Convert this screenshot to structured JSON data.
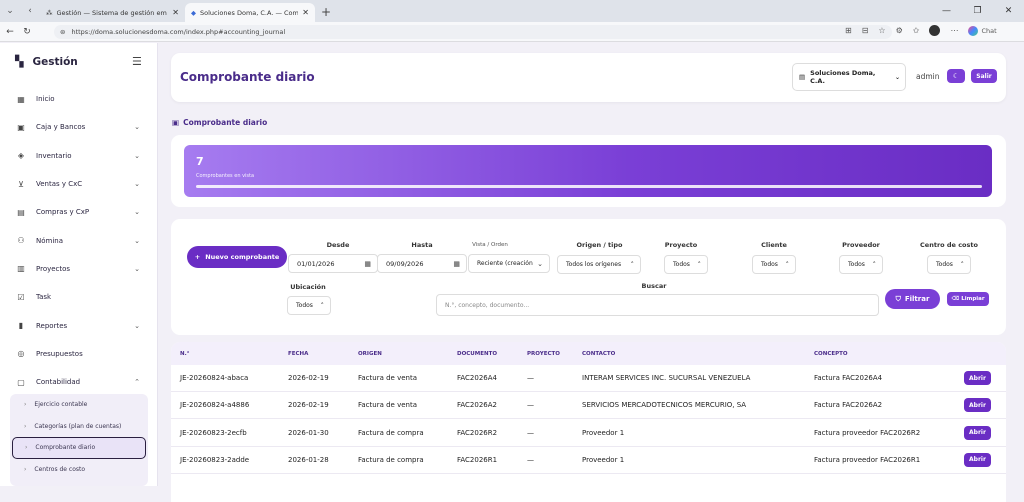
{
  "browser": {
    "tabs": [
      {
        "title": "Gestión — Sistema de gestión em",
        "active": false
      },
      {
        "title": "Soluciones Doma, C.A. — Compr",
        "active": true
      }
    ],
    "url": "https://doma.solucionesdoma.com/index.php#accounting_journal",
    "chat_label": "Chat"
  },
  "sidebar": {
    "brand": "Gestión",
    "items": [
      {
        "label": "Inicio",
        "icon": "dashboard-icon",
        "glyph": "▦",
        "chevron": ""
      },
      {
        "label": "Caja y Bancos",
        "icon": "bank-icon",
        "glyph": "▣",
        "chevron": "⌄"
      },
      {
        "label": "Inventario",
        "icon": "box-icon",
        "glyph": "◈",
        "chevron": "⌄"
      },
      {
        "label": "Ventas y CxC",
        "icon": "cart-icon",
        "glyph": "⊻",
        "chevron": "⌄"
      },
      {
        "label": "Compras y CxP",
        "icon": "truck-icon",
        "glyph": "▤",
        "chevron": "⌄"
      },
      {
        "label": "Nómina",
        "icon": "users-icon",
        "glyph": "⚇",
        "chevron": "⌄"
      },
      {
        "label": "Proyectos",
        "icon": "briefcase-icon",
        "glyph": "▥",
        "chevron": "⌄"
      },
      {
        "label": "Task",
        "icon": "checkbox-icon",
        "glyph": "☑",
        "chevron": ""
      },
      {
        "label": "Reportes",
        "icon": "bar-chart-icon",
        "glyph": "▮",
        "chevron": "⌄"
      },
      {
        "label": "Presupuestos",
        "icon": "target-icon",
        "glyph": "◎",
        "chevron": ""
      },
      {
        "label": "Contabilidad",
        "icon": "ledger-icon",
        "glyph": "▢",
        "chevron": "⌃"
      }
    ],
    "submenu": [
      {
        "label": "Ejercicio contable"
      },
      {
        "label": "Categorías (plan de cuentas)"
      },
      {
        "label": "Comprobante diario"
      },
      {
        "label": "Centros de costo"
      }
    ]
  },
  "header": {
    "title": "Comprobante diario",
    "company": "Soluciones Doma, C.A.",
    "user": "admin",
    "logout": "Salir"
  },
  "section_title": "Comprobante diario",
  "stats": {
    "count": "7",
    "label": "Comprobantes en vista"
  },
  "filters": {
    "new_button": "Nuevo comprobante",
    "desde_label": "Desde",
    "desde_value": "01/01/2026",
    "hasta_label": "Hasta",
    "hasta_value": "09/09/2026",
    "vista_label": "Vista / Orden",
    "vista_value": "Reciente (creación",
    "origen_label": "Origen / tipo",
    "origen_value": "Todos los orígenes",
    "proyecto_label": "Proyecto",
    "proyecto_value": "Todos",
    "cliente_label": "Cliente",
    "cliente_value": "Todos",
    "proveedor_label": "Proveedor",
    "proveedor_value": "Todos",
    "centro_label": "Centro de costo",
    "centro_value": "Todos",
    "ubicacion_label": "Ubicación",
    "ubicacion_value": "Todos",
    "buscar_label": "Buscar",
    "buscar_placeholder": "N.°, concepto, documento...",
    "filter_button": "Filtrar",
    "clear_button": "Limpiar"
  },
  "table": {
    "columns": [
      "N.°",
      "FECHA",
      "ORIGEN",
      "DOCUMENTO",
      "PROYECTO",
      "CONTACTO",
      "CONCEPTO"
    ],
    "action_label": "Abrir",
    "rows": [
      [
        "JE-20260824-abaca",
        "2026-02-19",
        "Factura de venta",
        "FAC2026A4",
        "—",
        "INTERAM SERVICES INC. SUCURSAL VENEZUELA",
        "Factura FAC2026A4"
      ],
      [
        "JE-20260824-a4886",
        "2026-02-19",
        "Factura de venta",
        "FAC2026A2",
        "—",
        "SERVICIOS MERCADOTECNICOS MERCURIO, SA",
        "Factura FAC2026A2"
      ],
      [
        "JE-20260823-2ecfb",
        "2026-01-30",
        "Factura de compra",
        "FAC2026R2",
        "—",
        "Proveedor 1",
        "Factura proveedor FAC2026R2"
      ],
      [
        "JE-20260823-2adde",
        "2026-01-28",
        "Factura de compra",
        "FAC2026R1",
        "—",
        "Proveedor 1",
        "Factura proveedor FAC2026R1"
      ]
    ]
  }
}
